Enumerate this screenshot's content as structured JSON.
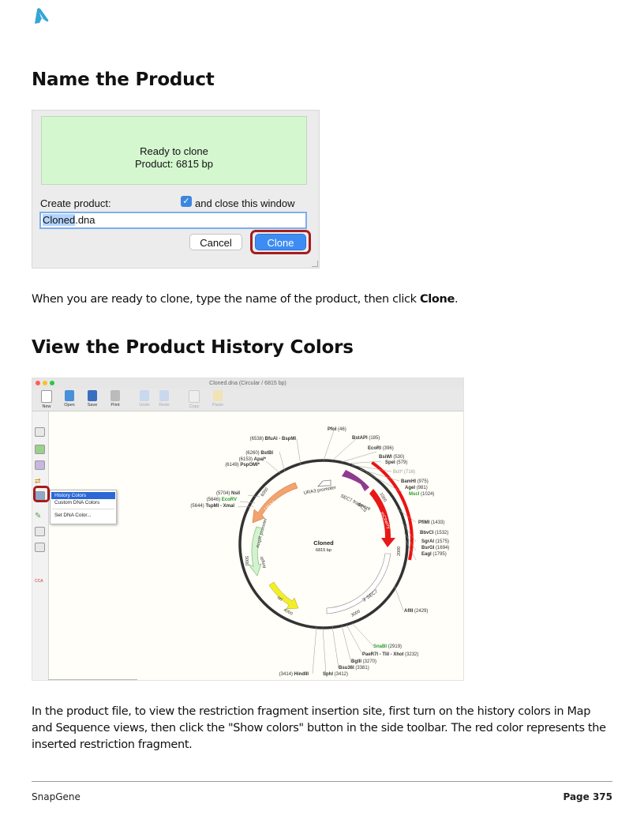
{
  "logo_icon": "snapgene-logo-icon",
  "sections": {
    "name_title": "Name the Product",
    "history_title": "View the Product History Colors"
  },
  "dialog": {
    "status_line1": "Ready to clone",
    "status_line2": "Product:  6815 bp",
    "create_label": "Create product:",
    "close_checkbox_checked": true,
    "close_checkbox_label": "and close this window",
    "name_selected": "Cloned",
    "name_rest": ".dna",
    "cancel_label": "Cancel",
    "clone_label": "Clone",
    "status_bg": "#d4f7cf",
    "accent": "#3d8cf3",
    "highlight_ring": "#a51d1d"
  },
  "para1": {
    "text": "When you are ready to clone, type the name of the product, then click ",
    "bold": "Clone",
    "end": "."
  },
  "window": {
    "title": "Cloned.dna  (Circular / 6815 bp)",
    "toolbar": [
      "New",
      "Open",
      "Save",
      "Print",
      "Undo",
      "Redo",
      "Copy",
      "Paste"
    ],
    "menu": [
      "History Colors",
      "Custom DNA Colors",
      "Set DNA Color..."
    ],
    "map_name": "Cloned",
    "map_size": "6815 bp",
    "sites": {
      "pfoi": "PfoI",
      "pfoi_pos": "(46)",
      "bstapi": "BstAPI",
      "bstapi_pos": "(185)",
      "ecori": "EcoRI",
      "ecori_pos": "(396)",
      "bsiwi": "BsiWI",
      "bsiwi_pos": "(530)",
      "spei": "SpeI",
      "spei_pos": "(579)",
      "bcli": "BclI*",
      "bcli_pos": "(716)",
      "bamhi": "BamHI",
      "bamhi_pos": "(975)",
      "agei": "AgeI",
      "agei_pos": "(981)",
      "msci": "MscI",
      "msci_pos": "(1024)",
      "pflmi": "PflMI",
      "pflmi_pos": "(1433)",
      "bbvci": "BbvCI",
      "bbvci_pos": "(1532)",
      "sgrai": "SgrAI",
      "sgrai_pos": "(1575)",
      "bsrgi": "BsrGI",
      "bsrgi_pos": "(1694)",
      "eagi": "EagI",
      "eagi_pos": "(1795)",
      "aflii": "AflII",
      "aflii_pos": "(2429)",
      "snabi": "SnaBI",
      "snabi_pos": "(2919)",
      "paer7i": "PaeR7I - TliI - XhoI",
      "paer7i_pos": "(3232)",
      "bglii": "BglII",
      "bglii_pos": "(3270)",
      "bsu36i": "Bsu36I",
      "bsu36i_pos": "(3381)",
      "sphi": "SphI",
      "sphi_pos": "(3412)",
      "hindiii_pos": "(3414)",
      "hindiii": "HindIII",
      "bfuai_pos": "(6538)",
      "bfuai": "BfuAI - BspMI",
      "bstbi_pos": "(6260)",
      "bstbi": "BstBI",
      "apai_pos": "(6153)",
      "apai": "ApaI*",
      "pspomi_pos": "(6149)",
      "pspomi": "PspOMI*",
      "nsii_pos": "(5704)",
      "nsii": "NsiI",
      "eco_pos": "(5646)",
      "eco": "EcoRV",
      "tspmi_pos": "(5644)",
      "tspmi": "TspMI - XmaI"
    },
    "features": {
      "ura3": "URA3",
      "ura3_promoter": "URA3 promoter",
      "sec7_fragment": "SEC7 fragment",
      "mcs": "MCS",
      "mcherry": "mCherry",
      "ampr_promoter": "AmpR promoter",
      "ampr": "AmpR",
      "ori": "ori",
      "sec7_3": "3' SEC7"
    },
    "ticks": {
      "t1000": "1000",
      "t2000": "2000",
      "t3000": "3000",
      "t4000": "4000",
      "t5000": "5000",
      "t6000": "6000"
    },
    "insert_color": "#ee1111"
  },
  "para2": "In the product file, to view the restriction fragment insertion site, first turn on the history colors in Map and Sequence views, then click the \"Show colors\" button in the side toolbar. The red color represents the inserted restriction fragment.",
  "footer": {
    "left": "SnapGene",
    "right": "Page 375"
  }
}
